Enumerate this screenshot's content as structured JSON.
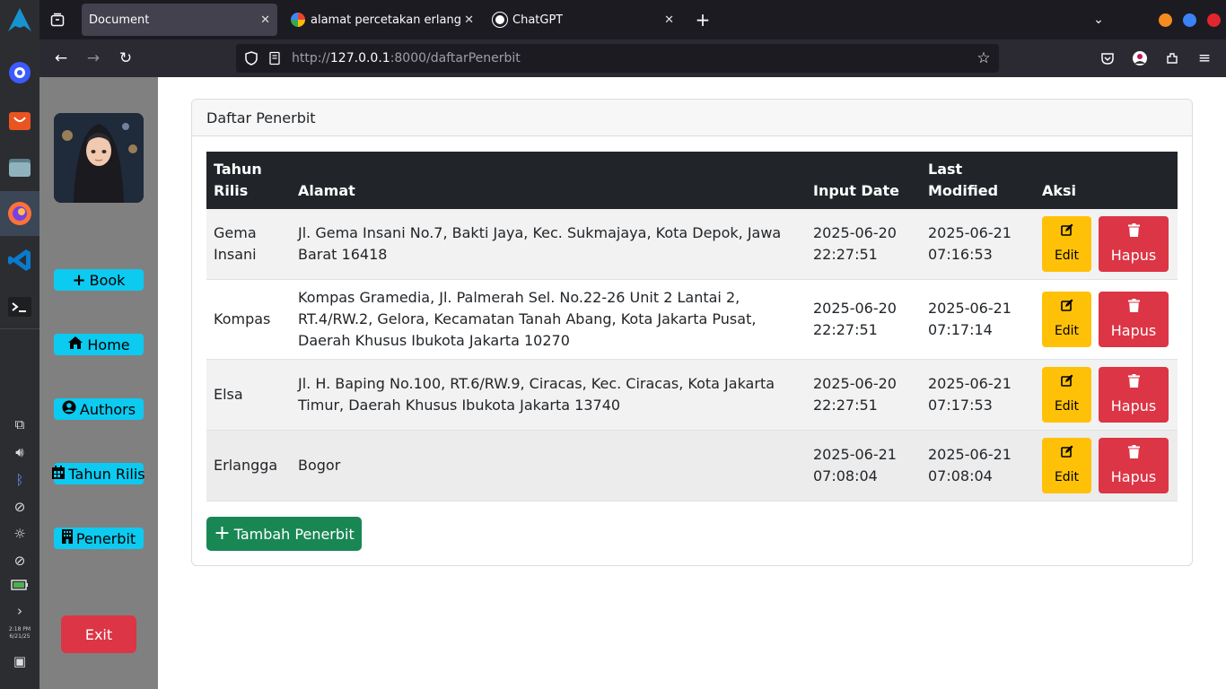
{
  "browser": {
    "tabs": [
      {
        "title": "Document",
        "active": true
      },
      {
        "title": "alamat percetakan erlangga",
        "active": false
      },
      {
        "title": "ChatGPT",
        "active": false
      }
    ],
    "url_prefix": "http://",
    "url_host": "127.0.0.1",
    "url_path": ":8000/daftarPenerbit"
  },
  "system_tray": {
    "time": "2:18 PM",
    "date": "6/21/25"
  },
  "sidebar": {
    "buttons": [
      {
        "label": "Book",
        "icon": "plus-icon"
      },
      {
        "label": "Home",
        "icon": "home-icon"
      },
      {
        "label": "Authors",
        "icon": "user-circle-icon"
      },
      {
        "label": "Tahun Rilis",
        "icon": "calendar-icon"
      },
      {
        "label": "Penerbit",
        "icon": "building-icon"
      }
    ],
    "exit_label": "Exit"
  },
  "card": {
    "title": "Daftar Penerbit",
    "columns": [
      "Tahun Rilis",
      "Alamat",
      "Input Date",
      "Last Modified",
      "Aksi"
    ],
    "rows": [
      {
        "name": "Gema Insani",
        "alamat": "Jl. Gema Insani No.7, Bakti Jaya, Kec. Sukmajaya, Kota Depok, Jawa Barat 16418",
        "input_date": "2025-06-20 22:27:51",
        "last_modified": "2025-06-21 07:16:53"
      },
      {
        "name": "Kompas",
        "alamat": "Kompas Gramedia, Jl. Palmerah Sel. No.22-26 Unit 2 Lantai 2, RT.4/RW.2, Gelora, Kecamatan Tanah Abang, Kota Jakarta Pusat, Daerah Khusus Ibukota Jakarta 10270",
        "input_date": "2025-06-20 22:27:51",
        "last_modified": "2025-06-21 07:17:14"
      },
      {
        "name": "Elsa",
        "alamat": "Jl. H. Baping No.100, RT.6/RW.9, Ciracas, Kec. Ciracas, Kota Jakarta Timur, Daerah Khusus Ibukota Jakarta 13740",
        "input_date": "2025-06-20 22:27:51",
        "last_modified": "2025-06-21 07:17:53"
      },
      {
        "name": "Erlangga",
        "alamat": "Bogor",
        "input_date": "2025-06-21 07:08:04",
        "last_modified": "2025-06-21 07:08:04"
      }
    ],
    "edit_label": "Edit",
    "delete_label": "Hapus",
    "add_label": "Tambah Penerbit"
  }
}
